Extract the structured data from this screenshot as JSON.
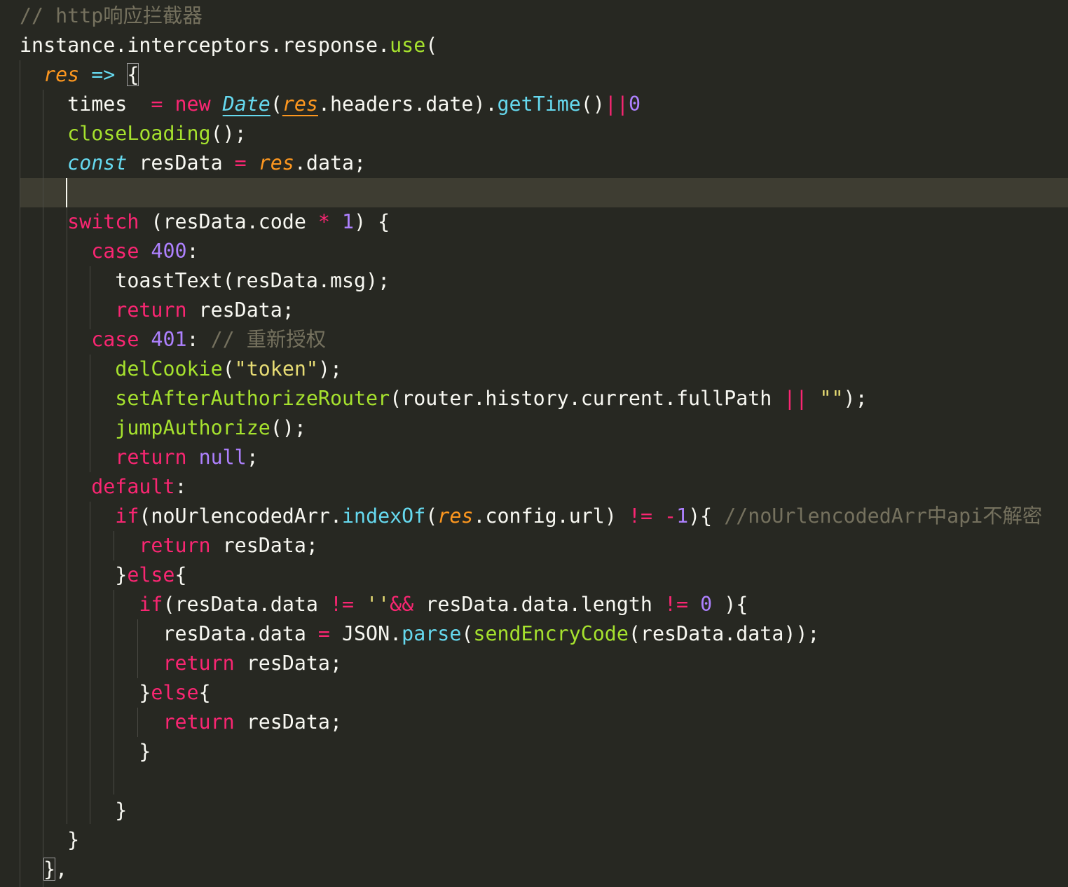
{
  "colors": {
    "background": "#272822",
    "current_line": "#3e3d32",
    "comment": "#75715e",
    "keyword": "#f92672",
    "storage": "#66d9ef",
    "parameter": "#fd971f",
    "function": "#a6e22e",
    "number": "#ae81ff",
    "string": "#e6db74",
    "text": "#f8f8f2"
  },
  "code": {
    "lines": [
      {
        "tokens": [
          {
            "t": "// http响应拦截器",
            "c": "c-comment"
          }
        ]
      },
      {
        "tokens": [
          {
            "t": "instance.interceptors.response.",
            "c": "c-plain"
          },
          {
            "t": "use",
            "c": "c-func"
          },
          {
            "t": "(",
            "c": "c-plain"
          }
        ]
      },
      {
        "tokens": [
          {
            "t": "  ",
            "c": "c-plain"
          },
          {
            "t": "res",
            "c": "c-param"
          },
          {
            "t": " ",
            "c": "c-plain"
          },
          {
            "t": "=>",
            "c": "c-storage"
          },
          {
            "t": " ",
            "c": "c-plain"
          },
          {
            "t": "{",
            "c": "c-plain bracket-match"
          }
        ]
      },
      {
        "tokens": [
          {
            "t": "    times  ",
            "c": "c-plain"
          },
          {
            "t": "=",
            "c": "c-op"
          },
          {
            "t": " ",
            "c": "c-plain"
          },
          {
            "t": "new",
            "c": "c-keyword"
          },
          {
            "t": " ",
            "c": "c-plain"
          },
          {
            "t": "Date",
            "c": "c-class-ul"
          },
          {
            "t": "(",
            "c": "c-plain"
          },
          {
            "t": "res",
            "c": "c-param-ul"
          },
          {
            "t": ".headers.date).",
            "c": "c-plain"
          },
          {
            "t": "getTime",
            "c": "c-builtin"
          },
          {
            "t": "()",
            "c": "c-plain"
          },
          {
            "t": "||",
            "c": "c-op"
          },
          {
            "t": "0",
            "c": "c-number"
          }
        ]
      },
      {
        "tokens": [
          {
            "t": "    ",
            "c": "c-plain"
          },
          {
            "t": "closeLoading",
            "c": "c-func"
          },
          {
            "t": "();",
            "c": "c-plain"
          }
        ]
      },
      {
        "tokens": [
          {
            "t": "    ",
            "c": "c-plain"
          },
          {
            "t": "const",
            "c": "c-storage"
          },
          {
            "t": " resData ",
            "c": "c-plain"
          },
          {
            "t": "=",
            "c": "c-op"
          },
          {
            "t": " ",
            "c": "c-plain"
          },
          {
            "t": "res",
            "c": "c-param"
          },
          {
            "t": ".data;",
            "c": "c-plain"
          }
        ]
      },
      {
        "tokens": []
      },
      {
        "tokens": [
          {
            "t": "    ",
            "c": "c-plain"
          },
          {
            "t": "switch",
            "c": "c-keyword"
          },
          {
            "t": " (resData.code ",
            "c": "c-plain"
          },
          {
            "t": "*",
            "c": "c-op"
          },
          {
            "t": " ",
            "c": "c-plain"
          },
          {
            "t": "1",
            "c": "c-number"
          },
          {
            "t": ") {",
            "c": "c-plain"
          }
        ]
      },
      {
        "tokens": [
          {
            "t": "      ",
            "c": "c-plain"
          },
          {
            "t": "case",
            "c": "c-keyword"
          },
          {
            "t": " ",
            "c": "c-plain"
          },
          {
            "t": "400",
            "c": "c-number"
          },
          {
            "t": ":",
            "c": "c-plain"
          }
        ]
      },
      {
        "tokens": [
          {
            "t": "        toastText(resData.msg);",
            "c": "c-plain"
          }
        ]
      },
      {
        "tokens": [
          {
            "t": "        ",
            "c": "c-plain"
          },
          {
            "t": "return",
            "c": "c-keyword"
          },
          {
            "t": " resData;",
            "c": "c-plain"
          }
        ]
      },
      {
        "tokens": [
          {
            "t": "      ",
            "c": "c-plain"
          },
          {
            "t": "case",
            "c": "c-keyword"
          },
          {
            "t": " ",
            "c": "c-plain"
          },
          {
            "t": "401",
            "c": "c-number"
          },
          {
            "t": ": ",
            "c": "c-plain"
          },
          {
            "t": "// 重新授权",
            "c": "c-comment"
          }
        ]
      },
      {
        "tokens": [
          {
            "t": "        ",
            "c": "c-plain"
          },
          {
            "t": "delCookie",
            "c": "c-func"
          },
          {
            "t": "(",
            "c": "c-plain"
          },
          {
            "t": "\"token\"",
            "c": "c-string"
          },
          {
            "t": ");",
            "c": "c-plain"
          }
        ]
      },
      {
        "tokens": [
          {
            "t": "        ",
            "c": "c-plain"
          },
          {
            "t": "setAfterAuthorizeRouter",
            "c": "c-func"
          },
          {
            "t": "(router.history.current.fullPath ",
            "c": "c-plain"
          },
          {
            "t": "||",
            "c": "c-op"
          },
          {
            "t": " ",
            "c": "c-plain"
          },
          {
            "t": "\"\"",
            "c": "c-string"
          },
          {
            "t": ");",
            "c": "c-plain"
          }
        ]
      },
      {
        "tokens": [
          {
            "t": "        ",
            "c": "c-plain"
          },
          {
            "t": "jumpAuthorize",
            "c": "c-func"
          },
          {
            "t": "();",
            "c": "c-plain"
          }
        ]
      },
      {
        "tokens": [
          {
            "t": "        ",
            "c": "c-plain"
          },
          {
            "t": "return",
            "c": "c-keyword"
          },
          {
            "t": " ",
            "c": "c-plain"
          },
          {
            "t": "null",
            "c": "c-number"
          },
          {
            "t": ";",
            "c": "c-plain"
          }
        ]
      },
      {
        "tokens": [
          {
            "t": "      ",
            "c": "c-plain"
          },
          {
            "t": "default",
            "c": "c-keyword"
          },
          {
            "t": ":",
            "c": "c-plain"
          }
        ]
      },
      {
        "tokens": [
          {
            "t": "        ",
            "c": "c-plain"
          },
          {
            "t": "if",
            "c": "c-keyword"
          },
          {
            "t": "(noUrlencodedArr.",
            "c": "c-plain"
          },
          {
            "t": "indexOf",
            "c": "c-builtin"
          },
          {
            "t": "(",
            "c": "c-plain"
          },
          {
            "t": "res",
            "c": "c-param"
          },
          {
            "t": ".config.url) ",
            "c": "c-plain"
          },
          {
            "t": "!=",
            "c": "c-op"
          },
          {
            "t": " ",
            "c": "c-plain"
          },
          {
            "t": "-",
            "c": "c-op"
          },
          {
            "t": "1",
            "c": "c-number"
          },
          {
            "t": "){ ",
            "c": "c-plain"
          },
          {
            "t": "//noUrlencodedArr中api不解密",
            "c": "c-comment"
          }
        ]
      },
      {
        "tokens": [
          {
            "t": "          ",
            "c": "c-plain"
          },
          {
            "t": "return",
            "c": "c-keyword"
          },
          {
            "t": " resData;",
            "c": "c-plain"
          }
        ]
      },
      {
        "tokens": [
          {
            "t": "        }",
            "c": "c-plain"
          },
          {
            "t": "else",
            "c": "c-keyword"
          },
          {
            "t": "{",
            "c": "c-plain"
          }
        ]
      },
      {
        "tokens": [
          {
            "t": "          ",
            "c": "c-plain"
          },
          {
            "t": "if",
            "c": "c-keyword"
          },
          {
            "t": "(resData.data ",
            "c": "c-plain"
          },
          {
            "t": "!=",
            "c": "c-op"
          },
          {
            "t": " ",
            "c": "c-plain"
          },
          {
            "t": "''",
            "c": "c-string"
          },
          {
            "t": "&&",
            "c": "c-op"
          },
          {
            "t": " resData.data.length ",
            "c": "c-plain"
          },
          {
            "t": "!=",
            "c": "c-op"
          },
          {
            "t": " ",
            "c": "c-plain"
          },
          {
            "t": "0",
            "c": "c-number"
          },
          {
            "t": " ){",
            "c": "c-plain"
          }
        ]
      },
      {
        "tokens": [
          {
            "t": "            resData.data ",
            "c": "c-plain"
          },
          {
            "t": "=",
            "c": "c-op"
          },
          {
            "t": " JSON.",
            "c": "c-plain"
          },
          {
            "t": "parse",
            "c": "c-builtin"
          },
          {
            "t": "(",
            "c": "c-plain"
          },
          {
            "t": "sendEncryCode",
            "c": "c-func"
          },
          {
            "t": "(resData.data));",
            "c": "c-plain"
          }
        ]
      },
      {
        "tokens": [
          {
            "t": "            ",
            "c": "c-plain"
          },
          {
            "t": "return",
            "c": "c-keyword"
          },
          {
            "t": " resData;",
            "c": "c-plain"
          }
        ]
      },
      {
        "tokens": [
          {
            "t": "          }",
            "c": "c-plain"
          },
          {
            "t": "else",
            "c": "c-keyword"
          },
          {
            "t": "{",
            "c": "c-plain"
          }
        ]
      },
      {
        "tokens": [
          {
            "t": "            ",
            "c": "c-plain"
          },
          {
            "t": "return",
            "c": "c-keyword"
          },
          {
            "t": " resData;",
            "c": "c-plain"
          }
        ]
      },
      {
        "tokens": [
          {
            "t": "          }",
            "c": "c-plain"
          }
        ]
      },
      {
        "tokens": []
      },
      {
        "tokens": [
          {
            "t": "        }",
            "c": "c-plain"
          }
        ]
      },
      {
        "tokens": [
          {
            "t": "    }",
            "c": "c-plain"
          }
        ]
      },
      {
        "tokens": [
          {
            "t": "  ",
            "c": "c-plain"
          },
          {
            "t": "}",
            "c": "c-plain bracket-match"
          },
          {
            "t": ",",
            "c": "c-plain"
          }
        ]
      }
    ]
  }
}
